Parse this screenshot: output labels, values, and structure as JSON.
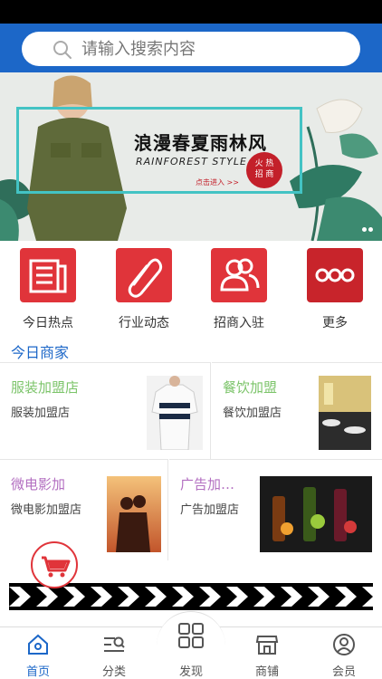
{
  "search": {
    "placeholder": "请输入搜索内容"
  },
  "banner": {
    "title": "浪漫春夏雨林风",
    "subtitle": "RAINFOREST STYLE",
    "cta": "点击进入 >>",
    "seal_line1": "火 热",
    "seal_line2": "招 商"
  },
  "quick": [
    {
      "label": "今日热点",
      "icon": "newspaper-icon"
    },
    {
      "label": "行业动态",
      "icon": "paperclip-icon"
    },
    {
      "label": "招商入驻",
      "icon": "users-icon"
    },
    {
      "label": "更多",
      "icon": "more-dots-icon"
    }
  ],
  "section": {
    "title": "今日商家"
  },
  "shops": [
    {
      "title": "服装加盟店",
      "subtitle": "服装加盟店",
      "title_color": "#7cc46a"
    },
    {
      "title": "餐饮加盟",
      "subtitle": "餐饮加盟店",
      "title_color": "#7cc46a"
    },
    {
      "title": "微电影加",
      "subtitle": "微电影加盟店",
      "title_color": "#b36fc1"
    },
    {
      "title": "广告加…",
      "subtitle": "广告加盟店",
      "title_color": "#b36fc1"
    }
  ],
  "tabbar": [
    {
      "label": "首页",
      "icon": "home-icon",
      "active": true
    },
    {
      "label": "分类",
      "icon": "category-search-icon",
      "active": false
    },
    {
      "label": "发现",
      "icon": "grid-icon",
      "active": false
    },
    {
      "label": "商铺",
      "icon": "store-icon",
      "active": false
    },
    {
      "label": "会员",
      "icon": "user-icon",
      "active": false
    }
  ],
  "colors": {
    "brand_blue": "#1c67c8",
    "accent_red": "#e0343a"
  }
}
